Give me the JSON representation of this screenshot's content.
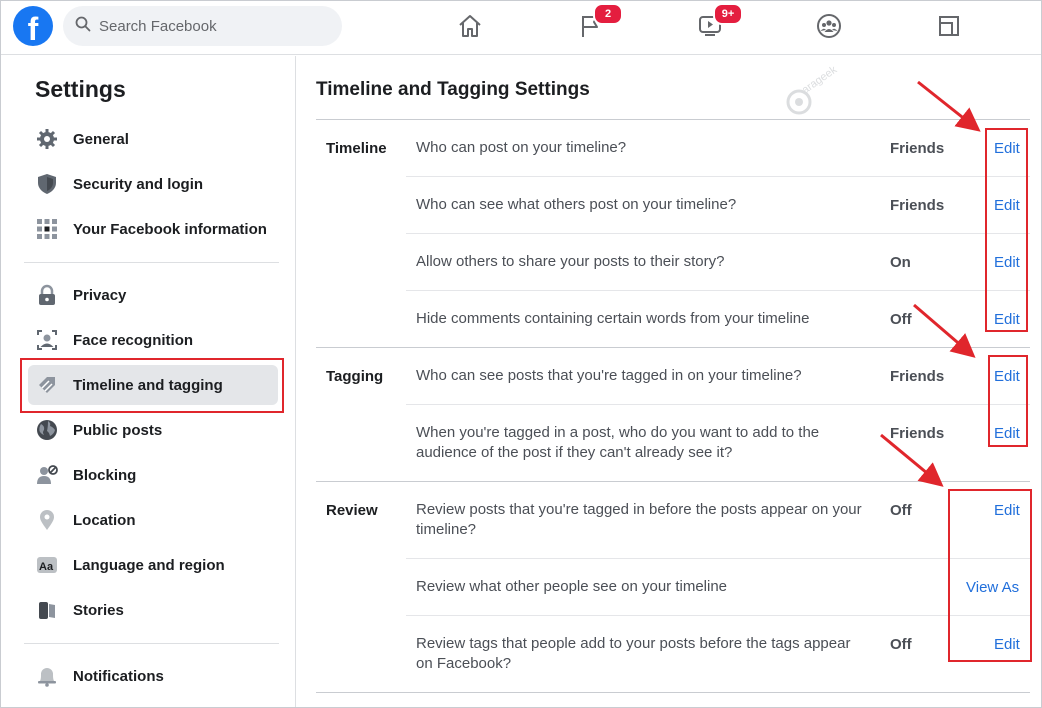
{
  "topbar": {
    "logo_letter": "f",
    "search_placeholder": "Search Facebook",
    "notifications_badge": "2",
    "watch_badge": "9+"
  },
  "sidebar": {
    "title": "Settings",
    "group1": [
      {
        "label": "General",
        "icon": "gear-icon"
      },
      {
        "label": "Security and login",
        "icon": "shield-icon"
      },
      {
        "label": "Your Facebook information",
        "icon": "grid-icon"
      }
    ],
    "group2": [
      {
        "label": "Privacy",
        "icon": "lock-icon"
      },
      {
        "label": "Face recognition",
        "icon": "face-recognition-icon"
      },
      {
        "label": "Timeline and tagging",
        "icon": "tag-icon"
      },
      {
        "label": "Public posts",
        "icon": "globe-icon"
      },
      {
        "label": "Blocking",
        "icon": "block-user-icon"
      },
      {
        "label": "Location",
        "icon": "location-pin-icon"
      },
      {
        "label": "Language and region",
        "icon": "language-icon"
      },
      {
        "label": "Stories",
        "icon": "stories-icon"
      }
    ],
    "group3": [
      {
        "label": "Notifications",
        "icon": "bell-icon"
      }
    ]
  },
  "main": {
    "title": "Timeline and Tagging Settings",
    "watermark": "arageek",
    "sections": {
      "timeline": {
        "label": "Timeline",
        "rows": [
          {
            "question": "Who can post on your timeline?",
            "value": "Friends",
            "action": "Edit"
          },
          {
            "question": "Who can see what others post on your timeline?",
            "value": "Friends",
            "action": "Edit"
          },
          {
            "question": "Allow others to share your posts to their story?",
            "value": "On",
            "action": "Edit"
          },
          {
            "question": "Hide comments containing certain words from your timeline",
            "value": "Off",
            "action": "Edit"
          }
        ]
      },
      "tagging": {
        "label": "Tagging",
        "rows": [
          {
            "question": "Who can see posts that you're tagged in on your timeline?",
            "value": "Friends",
            "action": "Edit"
          },
          {
            "question": "When you're tagged in a post, who do you want to add to the audience of the post if they can't already see it?",
            "value": "Friends",
            "action": "Edit"
          }
        ]
      },
      "review": {
        "label": "Review",
        "rows": [
          {
            "question": "Review posts that you're tagged in before the posts appear on your timeline?",
            "value": "Off",
            "action": "Edit"
          },
          {
            "question": "Review what other people see on your timeline",
            "value": "",
            "action": "View As"
          },
          {
            "question": "Review tags that people add to your posts before the tags appear on Facebook?",
            "value": "Off",
            "action": "Edit"
          }
        ]
      }
    }
  },
  "colors": {
    "brand": "#1877f2",
    "link": "#216fdb",
    "annotation_red": "#e0262c",
    "badge": "#e41e3f"
  }
}
